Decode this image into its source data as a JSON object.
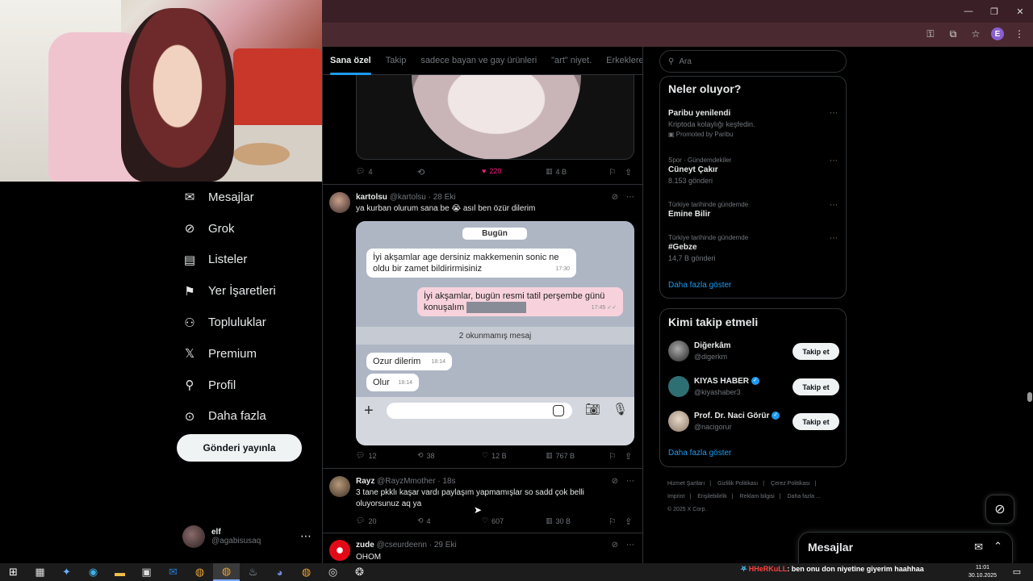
{
  "browser": {
    "window_controls": [
      "—",
      "❐",
      "✕"
    ],
    "profile_initial": "E"
  },
  "tabs": [
    {
      "label": "Sana özel",
      "active": true
    },
    {
      "label": "Takip",
      "active": false
    },
    {
      "label": "sadece bayan ve gay ürünleri",
      "active": false
    },
    {
      "label": "\"art\" niyet.",
      "active": false
    },
    {
      "label": "Erkeklere",
      "active": false
    }
  ],
  "nav": {
    "items": [
      {
        "label": "Mesajlar",
        "icon": "mail-icon"
      },
      {
        "label": "Grok",
        "icon": "grok-icon"
      },
      {
        "label": "Listeler",
        "icon": "list-icon"
      },
      {
        "label": "Yer İşaretleri",
        "icon": "bookmark-icon"
      },
      {
        "label": "Topluluklar",
        "icon": "communities-icon"
      },
      {
        "label": "Premium",
        "icon": "x-logo-icon"
      },
      {
        "label": "Profil",
        "icon": "profile-icon"
      },
      {
        "label": "Daha fazla",
        "icon": "more-circle-icon"
      }
    ],
    "post_button": "Gönderi yayınla",
    "me": {
      "name": "elf",
      "handle": "@agabisusaq"
    }
  },
  "feed": {
    "post0_actions": {
      "replies": "4",
      "retweets": "",
      "likes": "220",
      "views": "4 B"
    },
    "post1": {
      "name": "kartolsu",
      "handle": "@kartolsu",
      "date": "· 28 Eki",
      "text": "ya kurban olurum sana be 😭 asıl ben özür dilerim",
      "chat": {
        "day": "Bugün",
        "msg1": "İyi akşamlar age dersiniz makkemenin sonic ne oldu bir zamet bildirirmisiniz",
        "msg1_time": "17:30",
        "msg2": "İyi akşamlar, bugün resmi tatil perşembe günü konuşalım",
        "msg2_time": "17:45 ✓✓",
        "unread": "2 okunmamış mesaj",
        "msg3": "Ozur dilerim",
        "msg3_time": "18:14",
        "msg4": "Olur",
        "msg4_time": "18:14"
      },
      "actions": {
        "replies": "12",
        "retweets": "38",
        "likes": "12 B",
        "views": "767 B"
      }
    },
    "post2": {
      "name": "Rayz",
      "handle": "@RayzMmother",
      "date": "· 18s",
      "text": "3 tane pkklı kaşar vardı paylaşım yapmamışlar so sadd çok belli oluyorsunuz aq ya",
      "actions": {
        "replies": "20",
        "retweets": "4",
        "likes": "607",
        "views": "30 B"
      }
    },
    "post3": {
      "name": "zude",
      "handle": "@cseurdeenn",
      "date": "· 29 Eki",
      "text": "OHOM"
    }
  },
  "right": {
    "search_placeholder": "Ara",
    "trends_title": "Neler oluyor?",
    "trends": [
      {
        "meta": "",
        "title": "Paribu yenilendi",
        "sub": "Kriptoda kolaylığı keşfedin.",
        "sub2": "Promoted by Paribu"
      },
      {
        "meta": "Spor · Gündemdekiler",
        "title": "Cüneyt Çakır",
        "sub": "8.153 gönderi",
        "sub2": ""
      },
      {
        "meta": "Türkiye tarihinde gündemde",
        "title": "Emine Bilir",
        "sub": "",
        "sub2": ""
      },
      {
        "meta": "Türkiye tarihinde gündemde",
        "title": "#Gebze",
        "sub": "14,7 B gönderi",
        "sub2": ""
      }
    ],
    "trends_more": "Daha fazla göster",
    "who_title": "Kimi takip etmeli",
    "who": [
      {
        "name": "Diğerkâm",
        "handle": "@digerkm",
        "verified": false,
        "follow": "Takip et"
      },
      {
        "name": "KIYAS HABER",
        "handle": "@kiyashaber3",
        "verified": true,
        "follow": "Takip et"
      },
      {
        "name": "Prof. Dr. Naci Görür",
        "handle": "@nacigorur",
        "verified": true,
        "follow": "Takip et"
      }
    ],
    "who_more": "Daha fazla göster",
    "footer": [
      "Hizmet Şartları",
      "|",
      "Gizlilik Politikası",
      "|",
      "Çerez Politikası",
      "|",
      "Imprint",
      "|",
      "Erişilebilirlik",
      "|",
      "Reklam bilgisi",
      "|",
      "Daha fazla ...",
      "© 2025 X Corp."
    ]
  },
  "messages_drawer": {
    "title": "Mesajlar"
  },
  "taskbar": {
    "ticker_user": "HHeRKuLL",
    "ticker_text": ": ben onu don niyetine giyerim haahhaa",
    "time": "11:01",
    "date": "30.10.2025"
  }
}
